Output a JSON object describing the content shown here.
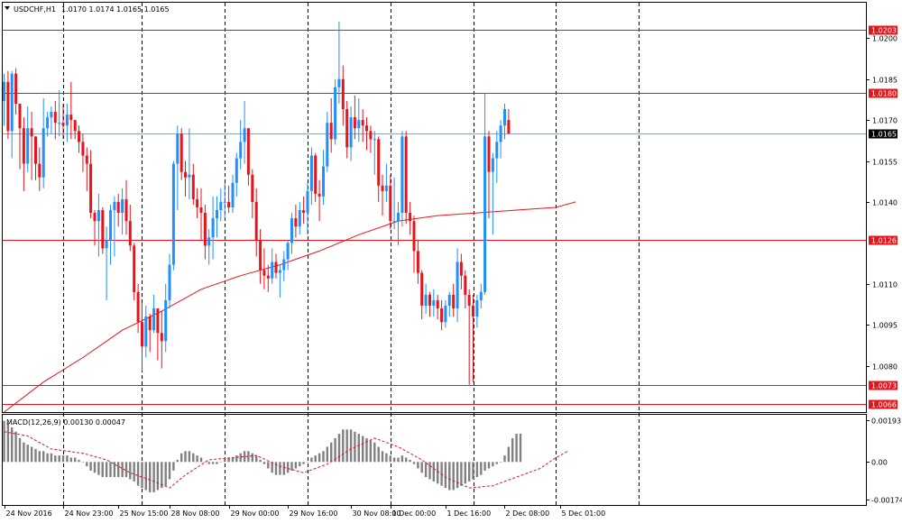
{
  "header": {
    "symbol_info": "USDCHF,H1",
    "ohlc": "1.0170 1.0174 1.0165 1.0165",
    "menu_icon": "triangle-down-icon"
  },
  "macd": {
    "label": "MACD(12,26,9) 0.00130 0.00047",
    "ticks": [
      "0.00193",
      "0.00",
      "-0.00174"
    ],
    "tick_values": [
      0.00193,
      0.0,
      -0.00174
    ]
  },
  "colors": {
    "bull": "#1e90ff",
    "bear": "#e8141c",
    "ma": "#e8141c",
    "level_line": "#e8141c",
    "current_line": "#8fa3b5",
    "grid": "#000000",
    "macd_hist": "#808080",
    "macd_signal": "#e8141c",
    "current_tag": "#000000"
  },
  "chart_data": {
    "type": "candlestick",
    "symbol": "USDCHF",
    "timeframe": "H1",
    "ylim": [
      1.0063,
      1.0213
    ],
    "y_ticks": [
      "1.0200",
      "1.0185",
      "1.0170",
      "1.0155",
      "1.0140",
      "1.0110",
      "1.0095",
      "1.0080"
    ],
    "y_tick_values": [
      1.02,
      1.0185,
      1.017,
      1.0155,
      1.014,
      1.011,
      1.0095,
      1.008
    ],
    "x_ticks": [
      "24 Nov 2016",
      "24 Nov 23:00",
      "25 Nov 15:00",
      "28 Nov 08:00",
      "29 Nov 00:00",
      "29 Nov 16:00",
      "30 Nov 08:00",
      "1 Dec 00:00",
      "1 Dec 16:00",
      "2 Dec 08:00",
      "5 Dec 01:00"
    ],
    "x_tick_bars": [
      0,
      15,
      29,
      42,
      57,
      72,
      88,
      98,
      112,
      127,
      141
    ],
    "vertical_grid_bars": [
      15,
      35,
      56,
      77,
      98,
      119,
      140,
      161
    ],
    "horizontal_levels": [
      {
        "value": 1.0203,
        "label": "1.0203"
      },
      {
        "value": 1.018,
        "label": "1.0180"
      },
      {
        "value": 1.0126,
        "label": "1.0126"
      },
      {
        "value": 1.0073,
        "label": "1.0073"
      },
      {
        "value": 1.0066,
        "label": "1.0066"
      }
    ],
    "current_price": {
      "value": 1.0165,
      "label": "1.0165"
    },
    "ohlc": [
      [
        1.0177,
        1.0187,
        1.0168,
        1.0184
      ],
      [
        1.0184,
        1.0188,
        1.0163,
        1.0166
      ],
      [
        1.0166,
        1.0188,
        1.0156,
        1.0187
      ],
      [
        1.0187,
        1.0189,
        1.0172,
        1.0176
      ],
      [
        1.0176,
        1.0176,
        1.0152,
        1.0167
      ],
      [
        1.0167,
        1.0171,
        1.0144,
        1.0154
      ],
      [
        1.0154,
        1.0175,
        1.0151,
        1.0167
      ],
      [
        1.0167,
        1.0173,
        1.0148,
        1.0164
      ],
      [
        1.0164,
        1.0164,
        1.0148,
        1.0154
      ],
      [
        1.0154,
        1.016,
        1.0144,
        1.0149
      ],
      [
        1.0149,
        1.0178,
        1.0145,
        1.0167
      ],
      [
        1.0167,
        1.0173,
        1.0164,
        1.0171
      ],
      [
        1.0171,
        1.0175,
        1.0165,
        1.0173
      ],
      [
        1.0173,
        1.0177,
        1.0163,
        1.0169
      ],
      [
        1.0169,
        1.0181,
        1.0164,
        1.0169
      ],
      [
        1.0169,
        1.0176,
        1.0163,
        1.0168
      ],
      [
        1.0168,
        1.0176,
        1.0162,
        1.0172
      ],
      [
        1.0172,
        1.0184,
        1.0163,
        1.017
      ],
      [
        1.017,
        1.017,
        1.0163,
        1.0166
      ],
      [
        1.0166,
        1.0168,
        1.0158,
        1.0162
      ],
      [
        1.0162,
        1.0165,
        1.0151,
        1.0157
      ],
      [
        1.0157,
        1.016,
        1.0144,
        1.0154
      ],
      [
        1.0154,
        1.0159,
        1.0134,
        1.0136
      ],
      [
        1.0136,
        1.0137,
        1.0124,
        1.0133
      ],
      [
        1.0133,
        1.0143,
        1.012,
        1.0137
      ],
      [
        1.0137,
        1.0138,
        1.0121,
        1.0123
      ],
      [
        1.0123,
        1.0131,
        1.0104,
        1.0126
      ],
      [
        1.0126,
        1.0139,
        1.0117,
        1.0137
      ],
      [
        1.0137,
        1.0142,
        1.012,
        1.014
      ],
      [
        1.014,
        1.0143,
        1.0131,
        1.0136
      ],
      [
        1.0136,
        1.0145,
        1.0128,
        1.0141
      ],
      [
        1.0141,
        1.0148,
        1.0128,
        1.0133
      ],
      [
        1.0133,
        1.0139,
        1.0122,
        1.0124
      ],
      [
        1.0124,
        1.0125,
        1.0104,
        1.0107
      ],
      [
        1.0107,
        1.011,
        1.0092,
        1.0096
      ],
      [
        1.0096,
        1.0103,
        1.0078,
        1.0087
      ],
      [
        1.0087,
        1.0102,
        1.0083,
        1.0098
      ],
      [
        1.0098,
        1.0099,
        1.0085,
        1.0093
      ],
      [
        1.0093,
        1.0106,
        1.0092,
        1.0101
      ],
      [
        1.0101,
        1.0101,
        1.0082,
        1.0092
      ],
      [
        1.0092,
        1.01,
        1.0079,
        1.0089
      ],
      [
        1.0089,
        1.011,
        1.0085,
        1.0104
      ],
      [
        1.0104,
        1.0121,
        1.0101,
        1.0117
      ],
      [
        1.0117,
        1.0155,
        1.0115,
        1.0154
      ],
      [
        1.0154,
        1.0168,
        1.0137,
        1.0165
      ],
      [
        1.0165,
        1.0167,
        1.0148,
        1.0151
      ],
      [
        1.0151,
        1.0155,
        1.0142,
        1.0149
      ],
      [
        1.0149,
        1.0167,
        1.0141,
        1.015
      ],
      [
        1.015,
        1.0154,
        1.0139,
        1.0141
      ],
      [
        1.0141,
        1.0145,
        1.0134,
        1.0138
      ],
      [
        1.0138,
        1.0145,
        1.0126,
        1.0136
      ],
      [
        1.0136,
        1.0139,
        1.0119,
        1.0124
      ],
      [
        1.0124,
        1.013,
        1.0117,
        1.0127
      ],
      [
        1.0127,
        1.0142,
        1.0119,
        1.0134
      ],
      [
        1.0134,
        1.0142,
        1.0127,
        1.0137
      ],
      [
        1.0137,
        1.0145,
        1.0133,
        1.014
      ],
      [
        1.014,
        1.0147,
        1.0134,
        1.014
      ],
      [
        1.014,
        1.0146,
        1.0136,
        1.0138
      ],
      [
        1.0138,
        1.015,
        1.0136,
        1.0147
      ],
      [
        1.0147,
        1.0158,
        1.0142,
        1.0156
      ],
      [
        1.0156,
        1.017,
        1.0152,
        1.0162
      ],
      [
        1.0162,
        1.0177,
        1.0154,
        1.0167
      ],
      [
        1.0167,
        1.0167,
        1.0146,
        1.015
      ],
      [
        1.015,
        1.0152,
        1.0134,
        1.014
      ],
      [
        1.014,
        1.0145,
        1.012,
        1.0126
      ],
      [
        1.0126,
        1.013,
        1.011,
        1.0115
      ],
      [
        1.0115,
        1.0123,
        1.0108,
        1.0113
      ],
      [
        1.0113,
        1.0117,
        1.0107,
        1.0112
      ],
      [
        1.0112,
        1.0123,
        1.011,
        1.0118
      ],
      [
        1.0118,
        1.0121,
        1.0112,
        1.0114
      ],
      [
        1.0114,
        1.0117,
        1.0105,
        1.0115
      ],
      [
        1.0115,
        1.0122,
        1.0111,
        1.0119
      ],
      [
        1.0119,
        1.0126,
        1.0115,
        1.0125
      ],
      [
        1.0125,
        1.0136,
        1.0121,
        1.0134
      ],
      [
        1.0134,
        1.0139,
        1.0127,
        1.0131
      ],
      [
        1.0131,
        1.014,
        1.0128,
        1.0137
      ],
      [
        1.0137,
        1.0142,
        1.0132,
        1.0136
      ],
      [
        1.0136,
        1.0147,
        1.0128,
        1.0144
      ],
      [
        1.0144,
        1.016,
        1.0139,
        1.0157
      ],
      [
        1.0157,
        1.0158,
        1.014,
        1.0143
      ],
      [
        1.0143,
        1.0148,
        1.0133,
        1.0142
      ],
      [
        1.0142,
        1.0159,
        1.0139,
        1.0153
      ],
      [
        1.0153,
        1.0173,
        1.0151,
        1.0169
      ],
      [
        1.0169,
        1.0178,
        1.0158,
        1.0163
      ],
      [
        1.0163,
        1.0185,
        1.0161,
        1.0182
      ],
      [
        1.0182,
        1.0206,
        1.0176,
        1.0185
      ],
      [
        1.0185,
        1.019,
        1.0168,
        1.0174
      ],
      [
        1.0174,
        1.0177,
        1.0156,
        1.016
      ],
      [
        1.016,
        1.0175,
        1.0155,
        1.0171
      ],
      [
        1.0171,
        1.0179,
        1.0163,
        1.0167
      ],
      [
        1.0167,
        1.0178,
        1.0162,
        1.017
      ],
      [
        1.017,
        1.0174,
        1.0162,
        1.0168
      ],
      [
        1.0168,
        1.0171,
        1.0159,
        1.0166
      ],
      [
        1.0166,
        1.0168,
        1.0158,
        1.0163
      ],
      [
        1.0163,
        1.0166,
        1.015,
        1.0163
      ],
      [
        1.0163,
        1.0164,
        1.014,
        1.0146
      ],
      [
        1.0146,
        1.015,
        1.0135,
        1.0144
      ],
      [
        1.0144,
        1.0154,
        1.014,
        1.0146
      ],
      [
        1.0146,
        1.015,
        1.013,
        1.0133
      ],
      [
        1.0133,
        1.0149,
        1.013,
        1.0133
      ],
      [
        1.0133,
        1.014,
        1.0124,
        1.0136
      ],
      [
        1.0136,
        1.0166,
        1.0131,
        1.0164
      ],
      [
        1.0164,
        1.0166,
        1.0132,
        1.0136
      ],
      [
        1.0136,
        1.014,
        1.0128,
        1.0133
      ],
      [
        1.0133,
        1.0135,
        1.0114,
        1.0122
      ],
      [
        1.0122,
        1.0126,
        1.011,
        1.0114
      ],
      [
        1.0114,
        1.0115,
        1.0097,
        1.0102
      ],
      [
        1.0102,
        1.011,
        1.0099,
        1.0106
      ],
      [
        1.0106,
        1.0107,
        1.0098,
        1.0102
      ],
      [
        1.0102,
        1.0108,
        1.0098,
        1.0104
      ],
      [
        1.0104,
        1.0106,
        1.0097,
        1.0101
      ],
      [
        1.0101,
        1.0104,
        1.0093,
        1.0096
      ],
      [
        1.0096,
        1.0104,
        1.0094,
        1.0102
      ],
      [
        1.0102,
        1.0107,
        1.0098,
        1.0106
      ],
      [
        1.0106,
        1.011,
        1.0098,
        1.0101
      ],
      [
        1.0101,
        1.0123,
        1.0096,
        1.0118
      ],
      [
        1.0118,
        1.0121,
        1.0108,
        1.0113
      ],
      [
        1.0113,
        1.0115,
        1.0101,
        1.0106
      ],
      [
        1.0106,
        1.0108,
        1.0073,
        1.0102
      ],
      [
        1.0102,
        1.0106,
        1.0074,
        1.0098
      ],
      [
        1.0098,
        1.0106,
        1.0094,
        1.0104
      ],
      [
        1.0104,
        1.011,
        1.0101,
        1.0107
      ],
      [
        1.0107,
        1.018,
        1.0106,
        1.0164
      ],
      [
        1.0164,
        1.0166,
        1.0134,
        1.0151
      ],
      [
        1.0151,
        1.0158,
        1.0128,
        1.0156
      ],
      [
        1.0156,
        1.0166,
        1.0147,
        1.0162
      ],
      [
        1.0162,
        1.017,
        1.0156,
        1.0168
      ],
      [
        1.0168,
        1.0176,
        1.0163,
        1.0174
      ],
      [
        1.017,
        1.0174,
        1.0165,
        1.0165
      ]
    ],
    "moving_average": [
      [
        0,
        1.0063
      ],
      [
        10,
        1.0074
      ],
      [
        20,
        1.0083
      ],
      [
        30,
        1.0093
      ],
      [
        40,
        1.01
      ],
      [
        50,
        1.0108
      ],
      [
        60,
        1.0113
      ],
      [
        70,
        1.0117
      ],
      [
        80,
        1.0122
      ],
      [
        90,
        1.0128
      ],
      [
        100,
        1.0133
      ],
      [
        110,
        1.0135
      ],
      [
        120,
        1.0136
      ],
      [
        130,
        1.0137
      ],
      [
        140,
        1.0138
      ],
      [
        145,
        1.014
      ]
    ],
    "macd_histogram": [
      0.0019,
      0.0018,
      0.0016,
      0.0014,
      0.0011,
      0.0009,
      0.0008,
      0.0007,
      0.0006,
      0.0005,
      0.0005,
      0.0004,
      0.0004,
      0.0003,
      0.0003,
      0.0003,
      0.0003,
      0.0002,
      0.0002,
      0.0001,
      0.0,
      -0.0002,
      -0.0004,
      -0.0005,
      -0.0006,
      -0.0007,
      -0.0007,
      -0.0007,
      -0.0007,
      -0.0007,
      -0.0007,
      -0.0007,
      -0.0008,
      -0.0009,
      -0.0011,
      -0.0012,
      -0.0013,
      -0.0014,
      -0.0014,
      -0.0013,
      -0.0012,
      -0.0011,
      -0.0008,
      -0.0004,
      0.0001,
      0.0004,
      0.0005,
      0.0005,
      0.0004,
      0.0003,
      0.0002,
      0.0,
      -0.0001,
      -0.0001,
      -0.0001,
      0.0,
      0.0001,
      0.0002,
      0.0002,
      0.0003,
      0.0004,
      0.0005,
      0.0005,
      0.0004,
      0.0003,
      0.0001,
      -0.0001,
      -0.0003,
      -0.0005,
      -0.0006,
      -0.0006,
      -0.0006,
      -0.0005,
      -0.0004,
      -0.0003,
      -0.0002,
      -0.0001,
      0.0,
      0.0002,
      0.0003,
      0.0004,
      0.0005,
      0.0007,
      0.0009,
      0.0011,
      0.0013,
      0.0015,
      0.0015,
      0.0015,
      0.0014,
      0.0013,
      0.0012,
      0.0011,
      0.001,
      0.0009,
      0.0007,
      0.0005,
      0.0004,
      0.0003,
      0.0002,
      0.0002,
      0.0003,
      0.0002,
      0.0001,
      -0.0001,
      -0.0003,
      -0.0005,
      -0.0007,
      -0.0008,
      -0.0009,
      -0.001,
      -0.0011,
      -0.0012,
      -0.0013,
      -0.0013,
      -0.0012,
      -0.0011,
      -0.001,
      -0.0009,
      -0.0008,
      -0.0007,
      -0.0006,
      -0.0004,
      -0.0003,
      -0.0002,
      -0.0001,
      0.0,
      0.0003,
      0.0007,
      0.0011,
      0.0013,
      0.0013
    ],
    "macd_signal": [
      [
        0,
        0.0014
      ],
      [
        6,
        0.0012
      ],
      [
        12,
        0.0006
      ],
      [
        20,
        0.0004
      ],
      [
        26,
        0.0001
      ],
      [
        32,
        -0.0005
      ],
      [
        38,
        -0.0009
      ],
      [
        42,
        -0.0012
      ],
      [
        46,
        -0.0006
      ],
      [
        52,
        0.0001
      ],
      [
        58,
        0.0002
      ],
      [
        64,
        0.0003
      ],
      [
        70,
        -0.0002
      ],
      [
        76,
        -0.0005
      ],
      [
        82,
        -0.0001
      ],
      [
        88,
        0.0006
      ],
      [
        94,
        0.0011
      ],
      [
        100,
        0.0007
      ],
      [
        106,
        0.0001
      ],
      [
        112,
        -0.0007
      ],
      [
        118,
        -0.0012
      ],
      [
        124,
        -0.0011
      ],
      [
        130,
        -0.0007
      ],
      [
        136,
        -0.0003
      ],
      [
        140,
        0.0002
      ],
      [
        143,
        0.0005
      ]
    ]
  }
}
